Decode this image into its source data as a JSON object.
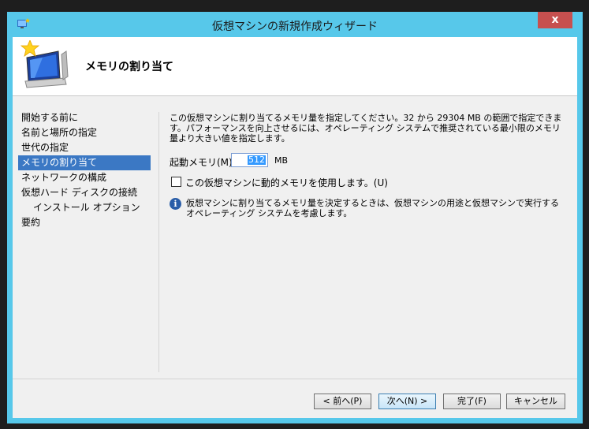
{
  "window": {
    "title": "仮想マシンの新規作成ウィザード",
    "close_label": "x",
    "accent_color": "#57c8ea"
  },
  "header": {
    "title": "メモリの割り当て",
    "icon": "computer-star-icon"
  },
  "nav": {
    "items": [
      {
        "label": "開始する前に"
      },
      {
        "label": "名前と場所の指定"
      },
      {
        "label": "世代の指定"
      },
      {
        "label": "メモリの割り当て",
        "selected": true
      },
      {
        "label": "ネットワークの構成"
      },
      {
        "label": "仮想ハード ディスクの接続"
      },
      {
        "label": "インストール オプション",
        "sub": true
      },
      {
        "label": "要約"
      }
    ]
  },
  "content": {
    "description": "この仮想マシンに割り当てるメモリ量を指定してください。32 から 29304 MB の範囲で指定できます。パフォーマンスを向上させるには、オペレーティング システムで推奨されている最小限のメモリ量より大きい値を指定します。",
    "startup_memory_label": "起動メモリ(M):",
    "startup_memory_value": "512",
    "memory_unit": "MB",
    "dynamic_memory_label": "この仮想マシンに動的メモリを使用します。(U)",
    "dynamic_memory_checked": false,
    "info_text": "仮想マシンに割り当てるメモリ量を決定するときは、仮想マシンの用途と仮想マシンで実行するオペレーティング システムを考慮します。"
  },
  "footer": {
    "prev_label": "< 前へ(P)",
    "next_label": "次へ(N) >",
    "finish_label": "完了(F)",
    "cancel_label": "キャンセル"
  }
}
